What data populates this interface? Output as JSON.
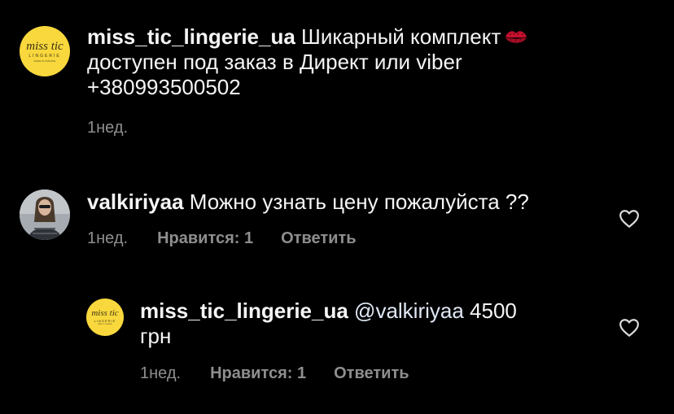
{
  "comments": [
    {
      "avatar": {
        "brand": "miss tic",
        "sub": "LINGERIE",
        "tiny": "MADE IN UKRAINE"
      },
      "username": "miss_tic_lingerie_ua",
      "text_line1": "Шикарный комплект",
      "emoji": "lips-emoji",
      "text_line2": "доступен под заказ в Директ или viber",
      "text_line3": "+380993500502",
      "time": "1нед."
    },
    {
      "username": "valkiriyaa",
      "text": "Можно узнать цену пожалуйста ??",
      "time": "1нед.",
      "likes": "Нравится: 1",
      "reply": "Ответить",
      "like_icon": "heart-outline-icon"
    },
    {
      "avatar": {
        "brand": "miss tic",
        "sub": "LINGERIE",
        "tiny": "MADE IN UKRAINE"
      },
      "username": "miss_tic_lingerie_ua",
      "mention": "@valkiriyaa",
      "text_tail": "4500",
      "text_line2": "грн",
      "time": "1нед.",
      "likes": "Нравится: 1",
      "reply": "Ответить",
      "like_icon": "heart-outline-icon"
    }
  ],
  "colors": {
    "background": "#000000",
    "text": "#f5f5f5",
    "meta": "#8e8e8e",
    "brand_yellow": "#f9d83d"
  }
}
